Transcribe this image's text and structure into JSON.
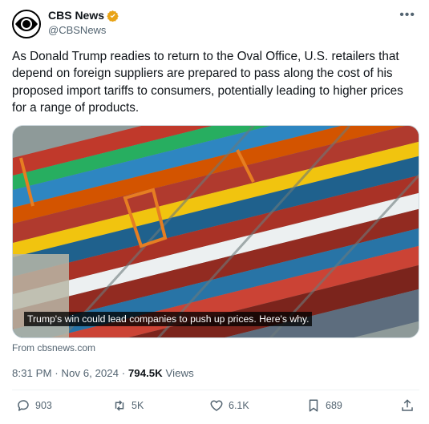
{
  "author": {
    "name": "CBS News",
    "handle": "@CBSNews",
    "verified_color": "#e8a316"
  },
  "tweet": {
    "text": "As Donald Trump readies to return to the Oval Office, U.S. retailers that depend on foreign suppliers are prepared to pass along the cost of his proposed import tariffs to consumers, potentially leading to higher prices for a range of products."
  },
  "media": {
    "caption": "Trump's win could lead companies to push up prices. Here's why.",
    "source": "From cbsnews.com"
  },
  "meta": {
    "time": "8:31 PM",
    "separator1": " · ",
    "date": "Nov 6, 2024",
    "separator2": " · ",
    "views_count": "794.5K",
    "views_label": " Views"
  },
  "actions": {
    "replies": "903",
    "reposts": "5K",
    "likes": "6.1K",
    "bookmarks": "689"
  },
  "icons": [
    "cbs-eye-icon",
    "verified-badge-icon",
    "more-icon",
    "reply-icon",
    "repost-icon",
    "like-icon",
    "bookmark-icon",
    "share-icon"
  ]
}
